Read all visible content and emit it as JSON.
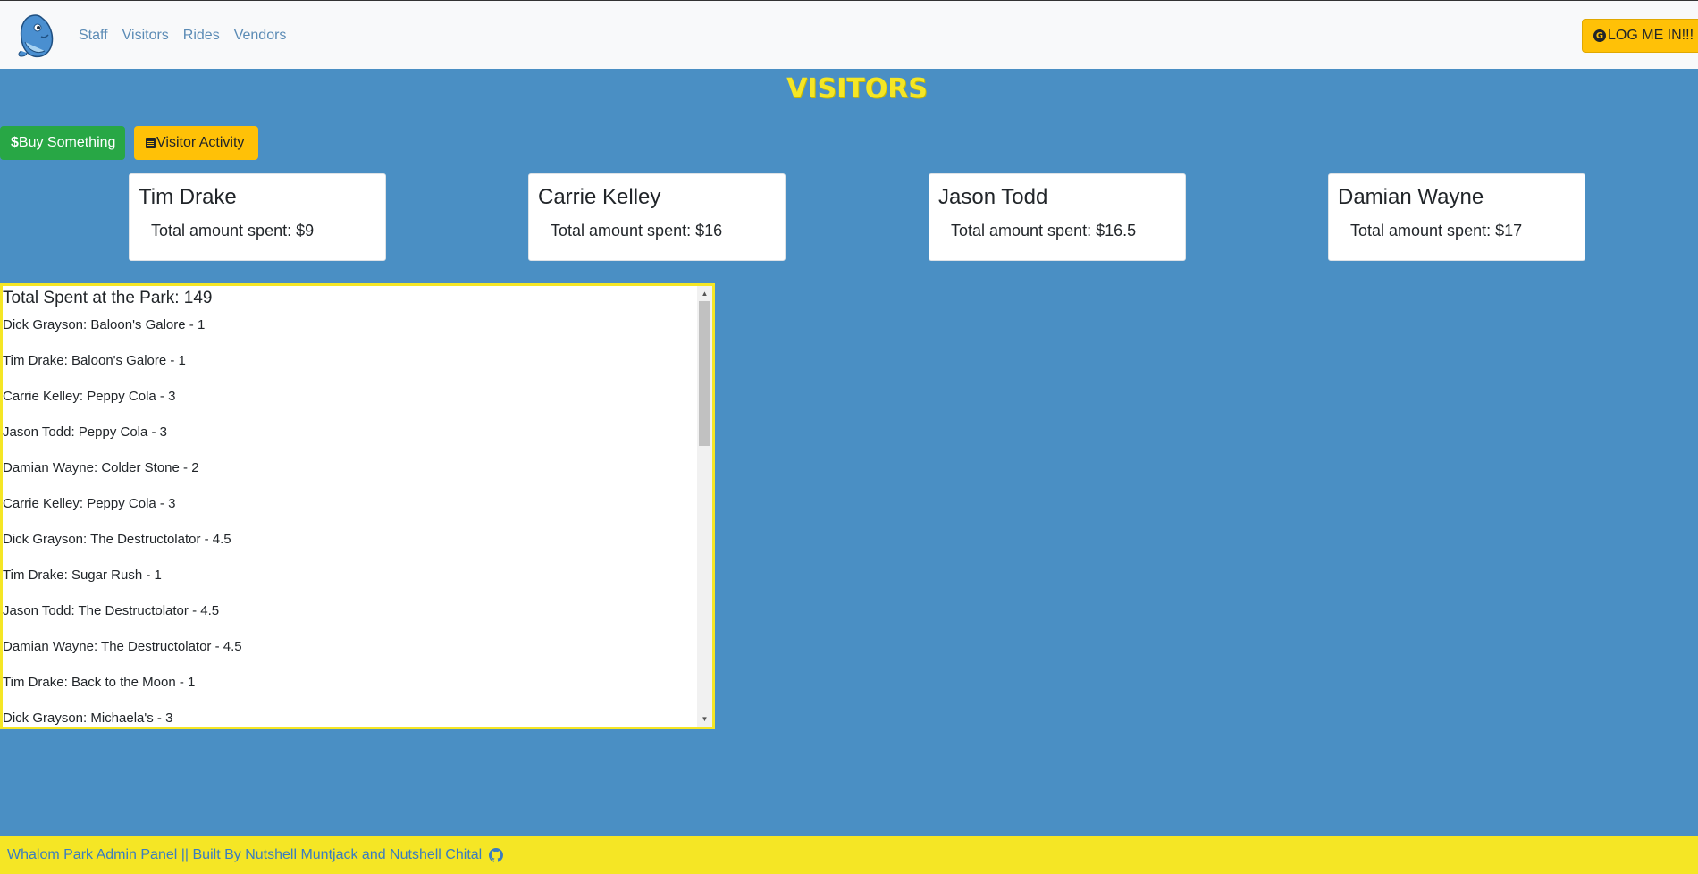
{
  "nav": {
    "links": [
      "Staff",
      "Visitors",
      "Rides",
      "Vendors"
    ],
    "login_label": "LOG ME IN!!!"
  },
  "page_title": "VISITORS",
  "actions": {
    "buy_label": "Buy Something",
    "activity_label": "Visitor Activity"
  },
  "cards": [
    {
      "name": "Tim Drake",
      "amount": "Total amount spent: $9"
    },
    {
      "name": "Carrie Kelley",
      "amount": "Total amount spent: $16"
    },
    {
      "name": "Jason Todd",
      "amount": "Total amount spent: $16.5"
    },
    {
      "name": "Damian Wayne",
      "amount": "Total amount spent: $17"
    }
  ],
  "activity": {
    "title": "Total Spent at the Park: 149",
    "items": [
      "Dick Grayson: Baloon's Galore - 1",
      "Tim Drake: Baloon's Galore - 1",
      "Carrie Kelley: Peppy Cola - 3",
      "Jason Todd: Peppy Cola - 3",
      "Damian Wayne: Colder Stone - 2",
      "Carrie Kelley: Peppy Cola - 3",
      "Dick Grayson: The Destructolator - 4.5",
      "Tim Drake: Sugar Rush - 1",
      "Jason Todd: The Destructolator - 4.5",
      "Damian Wayne: The Destructolator - 4.5",
      "Tim Drake: Back to the Moon - 1",
      "Dick Grayson: Michaela's - 3"
    ]
  },
  "footer": {
    "text": "Whalom Park Admin Panel || Built By Nutshell Muntjack and Nutshell Chital"
  },
  "colors": {
    "background": "#4a8fc4",
    "accent_yellow": "#f5e625",
    "button_green": "#28a745",
    "button_yellow": "#ffc107",
    "link_blue": "#5b8bb5"
  }
}
